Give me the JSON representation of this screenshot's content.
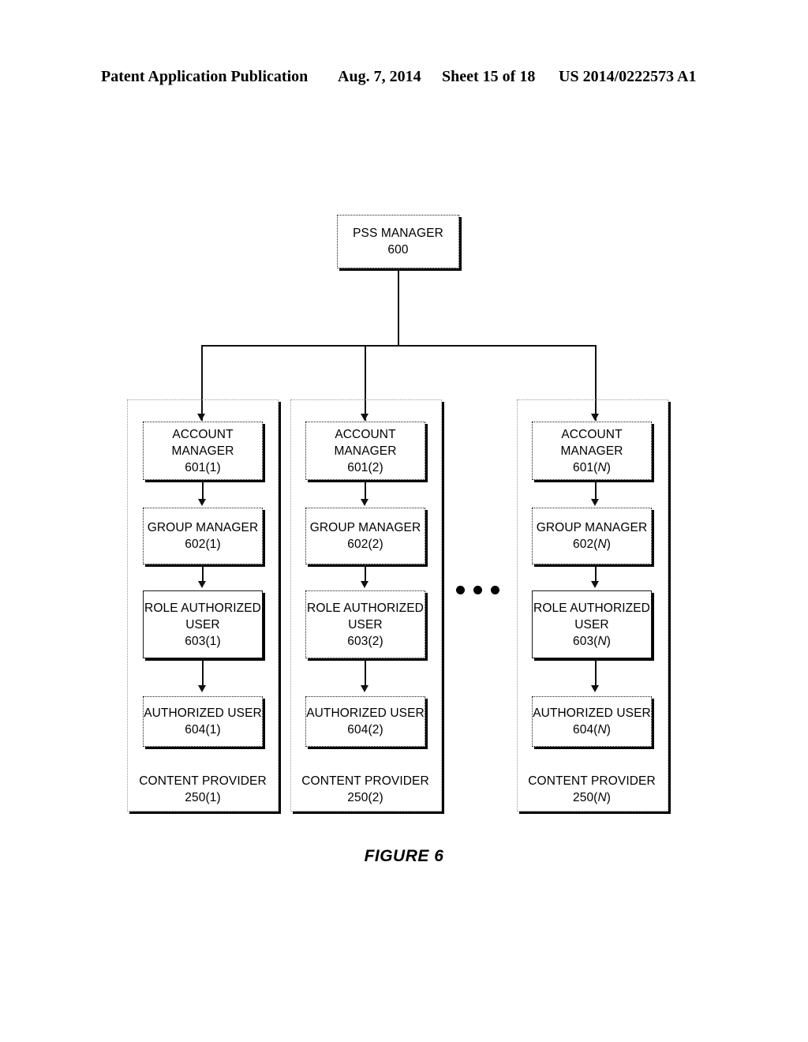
{
  "header": {
    "publication": "Patent Application Publication",
    "date": "Aug. 7, 2014",
    "sheet": "Sheet 15 of 18",
    "patent_number": "US 2014/0222573 A1"
  },
  "figure": {
    "caption": "FIGURE 6"
  },
  "diagram": {
    "root": {
      "title": "PSS MANAGER",
      "ref": "600"
    },
    "ellipsis": "● ● ●",
    "columns": [
      {
        "account_manager": {
          "line1": "ACCOUNT",
          "line2": "MANAGER",
          "ref": "601(1)"
        },
        "group_manager": {
          "line1": "GROUP MANAGER",
          "ref": "602(1)"
        },
        "role_authorized_user": {
          "line1": "ROLE AUTHORIZED",
          "line2": "USER",
          "ref": "603(1)"
        },
        "authorized_user": {
          "line1": "AUTHORIZED USER",
          "ref": "604(1)"
        },
        "content_provider": {
          "line1": "CONTENT PROVIDER",
          "ref": "250(1)"
        }
      },
      {
        "account_manager": {
          "line1": "ACCOUNT",
          "line2": "MANAGER",
          "ref": "601(2)"
        },
        "group_manager": {
          "line1": "GROUP MANAGER",
          "ref": "602(2)"
        },
        "role_authorized_user": {
          "line1": "ROLE AUTHORIZED",
          "line2": "USER",
          "ref": "603(2)"
        },
        "authorized_user": {
          "line1": "AUTHORIZED USER",
          "ref": "604(2)"
        },
        "content_provider": {
          "line1": "CONTENT PROVIDER",
          "ref": "250(2)"
        }
      },
      {
        "account_manager": {
          "line1": "ACCOUNT",
          "line2": "MANAGER",
          "ref_num": "601(",
          "ref_var": "N",
          "ref_end": ")"
        },
        "group_manager": {
          "line1": "GROUP MANAGER",
          "ref_num": "602(",
          "ref_var": "N",
          "ref_end": ")"
        },
        "role_authorized_user": {
          "line1": "ROLE AUTHORIZED",
          "line2": "USER",
          "ref_num": "603(",
          "ref_var": "N",
          "ref_end": ")"
        },
        "authorized_user": {
          "line1": "AUTHORIZED USER",
          "ref_num": "604(",
          "ref_var": "N",
          "ref_end": ")"
        },
        "content_provider": {
          "line1": "CONTENT PROVIDER",
          "ref_num": "250(",
          "ref_var": "N",
          "ref_end": ")"
        }
      }
    ]
  },
  "colors": {
    "ink": "#000000",
    "paper": "#ffffff",
    "group_border": "#9a9a9a"
  }
}
